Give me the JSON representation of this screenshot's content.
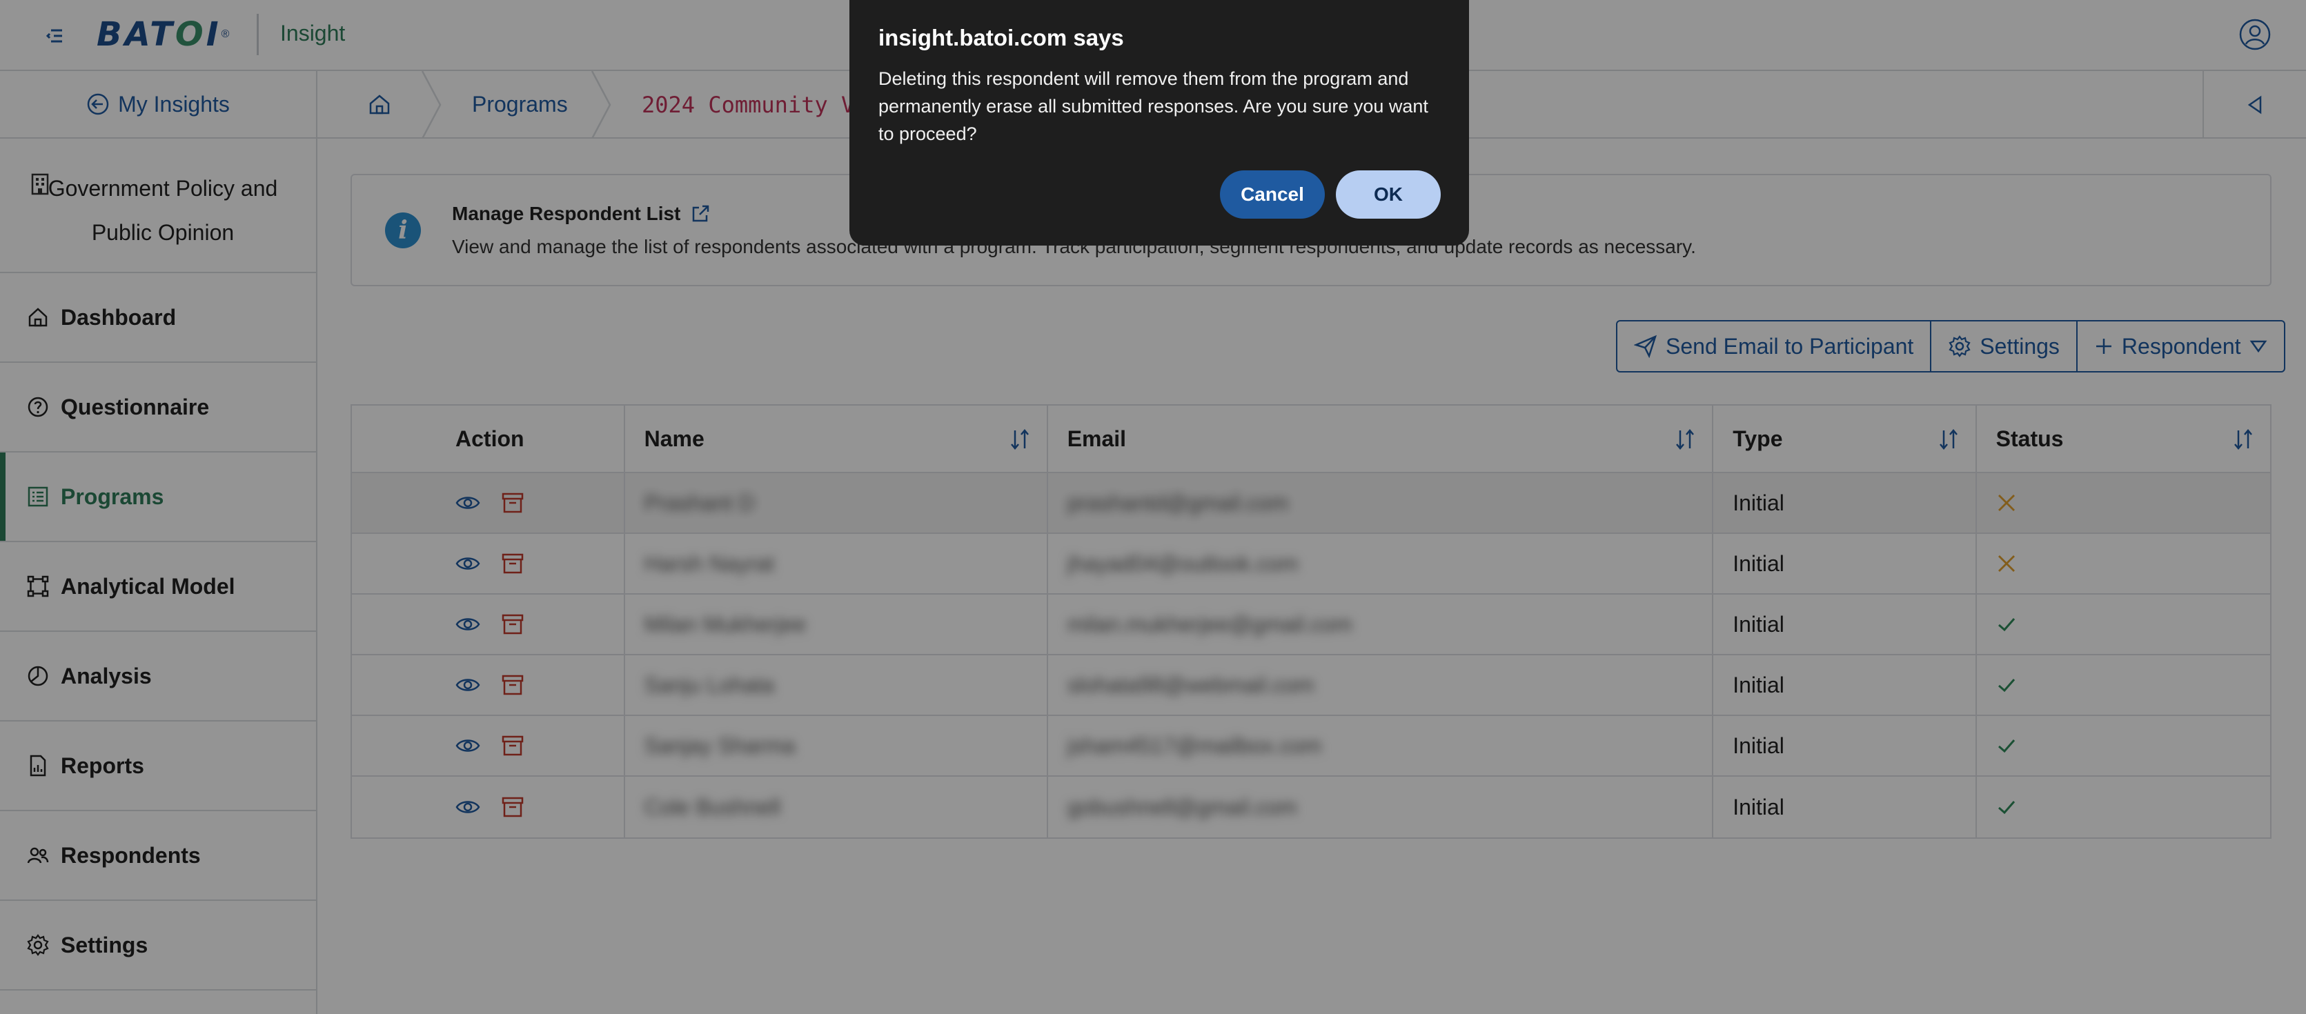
{
  "header": {
    "brand_logo": "BAT",
    "brand_logo_o": "O",
    "brand_logo_end": "I",
    "brand_reg": "®",
    "app_name": "Insight"
  },
  "sidebar": {
    "my_insights": "My Insights",
    "org_name": "Government Policy and Public Opinion",
    "items": [
      {
        "label": "Dashboard",
        "icon": "home-icon"
      },
      {
        "label": "Questionnaire",
        "icon": "question-icon"
      },
      {
        "label": "Programs",
        "icon": "programs-icon",
        "active": true
      },
      {
        "label": "Analytical Model",
        "icon": "model-icon"
      },
      {
        "label": "Analysis",
        "icon": "pie-chart-icon"
      },
      {
        "label": "Reports",
        "icon": "report-icon"
      },
      {
        "label": "Respondents",
        "icon": "users-icon"
      },
      {
        "label": "Settings",
        "icon": "gear-icon"
      }
    ],
    "active_color": "#2f7d5b"
  },
  "breadcrumb": {
    "programs": "Programs",
    "current": "2024 Community Voi"
  },
  "info": {
    "icon_glyph": "i",
    "title": "Manage Respondent List",
    "description": "View and manage the list of respondents associated with a program. Track participation, segment respondents, and update records as necessary."
  },
  "toolbar": {
    "send_email": "Send Email to Participant",
    "settings": "Settings",
    "respondent": "Respondent"
  },
  "table": {
    "headers": {
      "action": "Action",
      "name": "Name",
      "email": "Email",
      "type": "Type",
      "status": "Status"
    },
    "rows": [
      {
        "name": "Prashant D",
        "email": "prashantd@gmail.com",
        "type": "Initial",
        "status": "pending"
      },
      {
        "name": "Harsh Nayrat",
        "email": "jhayad04@outlook.com",
        "type": "Initial",
        "status": "pending"
      },
      {
        "name": "Milan Mukherjee",
        "email": "milan.mukherjee@gmail.com",
        "type": "Initial",
        "status": "completed"
      },
      {
        "name": "Sanju Lohata",
        "email": "slohata98@webmail.com",
        "type": "Initial",
        "status": "completed"
      },
      {
        "name": "Sanjay Sharma",
        "email": "jsham4517@mailbox.com",
        "type": "Initial",
        "status": "completed"
      },
      {
        "name": "Cole Bushnell",
        "email": "gobushnell@gmail.com",
        "type": "Initial",
        "status": "completed"
      }
    ]
  },
  "dialog": {
    "title": "insight.batoi.com says",
    "message": "Deleting this respondent will remove them from the program and permanently erase all submitted responses. Are you sure you want to proceed?",
    "cancel": "Cancel",
    "ok": "OK"
  },
  "colors": {
    "primary": "#1f5aa0",
    "accent_green": "#2f7d5b",
    "delete_red": "#c0392b",
    "pending_orange": "#e0a030",
    "complete_green": "#2f8a5b"
  }
}
